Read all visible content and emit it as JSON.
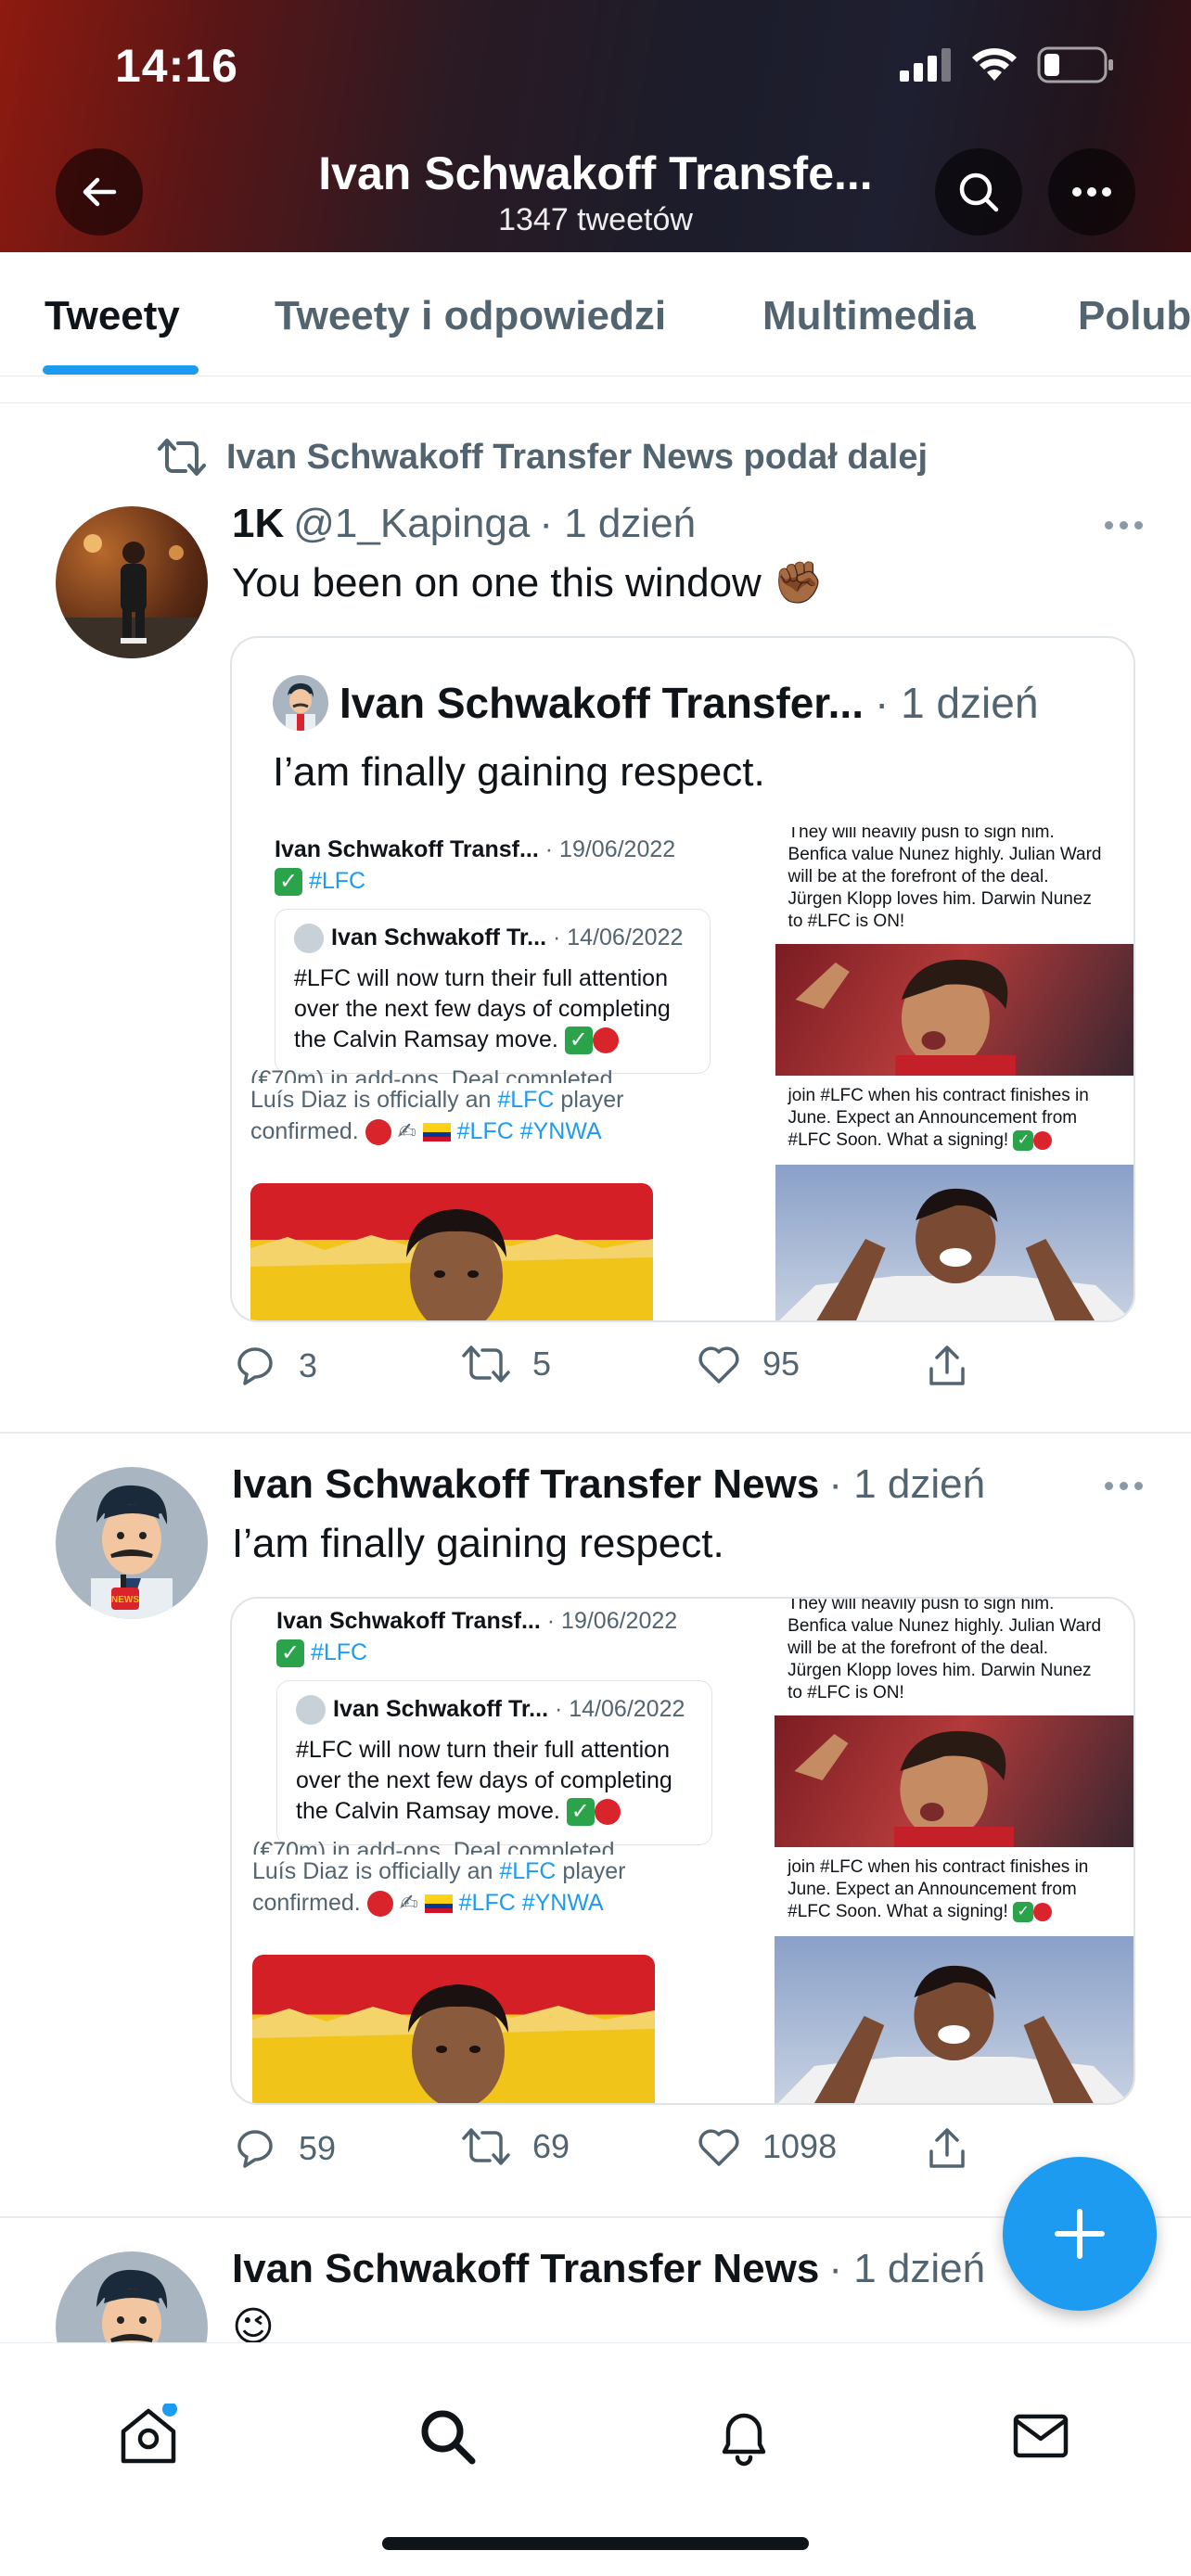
{
  "status": {
    "time": "14:16"
  },
  "header": {
    "title": "Ivan Schwakoff Transfe...",
    "subtitle": "1347 tweetów"
  },
  "tabs": [
    {
      "label": "Tweety",
      "active": true
    },
    {
      "label": "Tweety i odpowiedzi",
      "active": false
    },
    {
      "label": "Multimedia",
      "active": false
    },
    {
      "label": "Polub",
      "active": false
    }
  ],
  "colors": {
    "accent": "#1d9bf0",
    "text": "#0f1419",
    "muted": "#536471"
  },
  "tweet1": {
    "retweet_label": "Ivan Schwakoff Transfer News podał dalej",
    "display_name": "1K",
    "handle": "@1_Kapinga",
    "time": "· 1 dzień",
    "text": "You been on one this window ✊🏾",
    "quote": {
      "name": "Ivan Schwakoff Transfer...",
      "time": "· 1 dzień",
      "text": "I’am finally gaining respect."
    },
    "stats": {
      "replies": "3",
      "retweets": "5",
      "likes": "95"
    }
  },
  "media": {
    "post_name": "Ivan Schwakoff Transf...",
    "post_date": "· 19/06/2022",
    "post_tag": "#LFC",
    "inner_name": "Ivan Schwakoff Tr...",
    "inner_date": "· 14/06/2022",
    "inner_line1": "#LFC will now turn their full attention",
    "inner_line2": "over the next few days of completing",
    "inner_line3": "the Calvin Ramsay move.",
    "cut_line": "(€70m) in add-ons. Deal completed,",
    "diaz_line1_a": "Luís Diaz is officially an ",
    "diaz_line1_tag": "#LFC",
    "diaz_line1_b": " player",
    "diaz_line2_a": "confirmed.",
    "diaz_tags": "#LFC #YNWA",
    "nunez_line1": "They will heavily push to sign him.",
    "nunez_line2": "Benfica value Nunez highly. Julian Ward",
    "nunez_line3": "will be at the forefront of the deal.",
    "nunez_line4": "Jürgen Klopp loves him. Darwin Nunez",
    "nunez_line5": "to #LFC is ON!",
    "carvalho_line1": "join #LFC when his contract finishes in",
    "carvalho_line2": "June. Expect an Announcement from",
    "carvalho_line3": "#LFC Soon. What a signing!"
  },
  "tweet2": {
    "display_name": "Ivan Schwakoff Transfer News",
    "time": "· 1 dzień",
    "text": "I’am finally gaining respect.",
    "stats": {
      "replies": "59",
      "retweets": "69",
      "likes": "1098"
    }
  },
  "tweet3": {
    "display_name": "Ivan Schwakoff Transfer News",
    "time": "· 1 dzień",
    "text": "😉"
  },
  "icons": {
    "back": "arrow-left-icon",
    "search": "search-icon",
    "more": "more-icon",
    "retweet": "retweet-icon",
    "reply": "reply-icon",
    "like": "heart-icon",
    "share": "share-icon",
    "compose": "plus-icon",
    "home": "home-icon",
    "explore": "search-icon",
    "notifications": "bell-icon",
    "messages": "mail-icon"
  }
}
